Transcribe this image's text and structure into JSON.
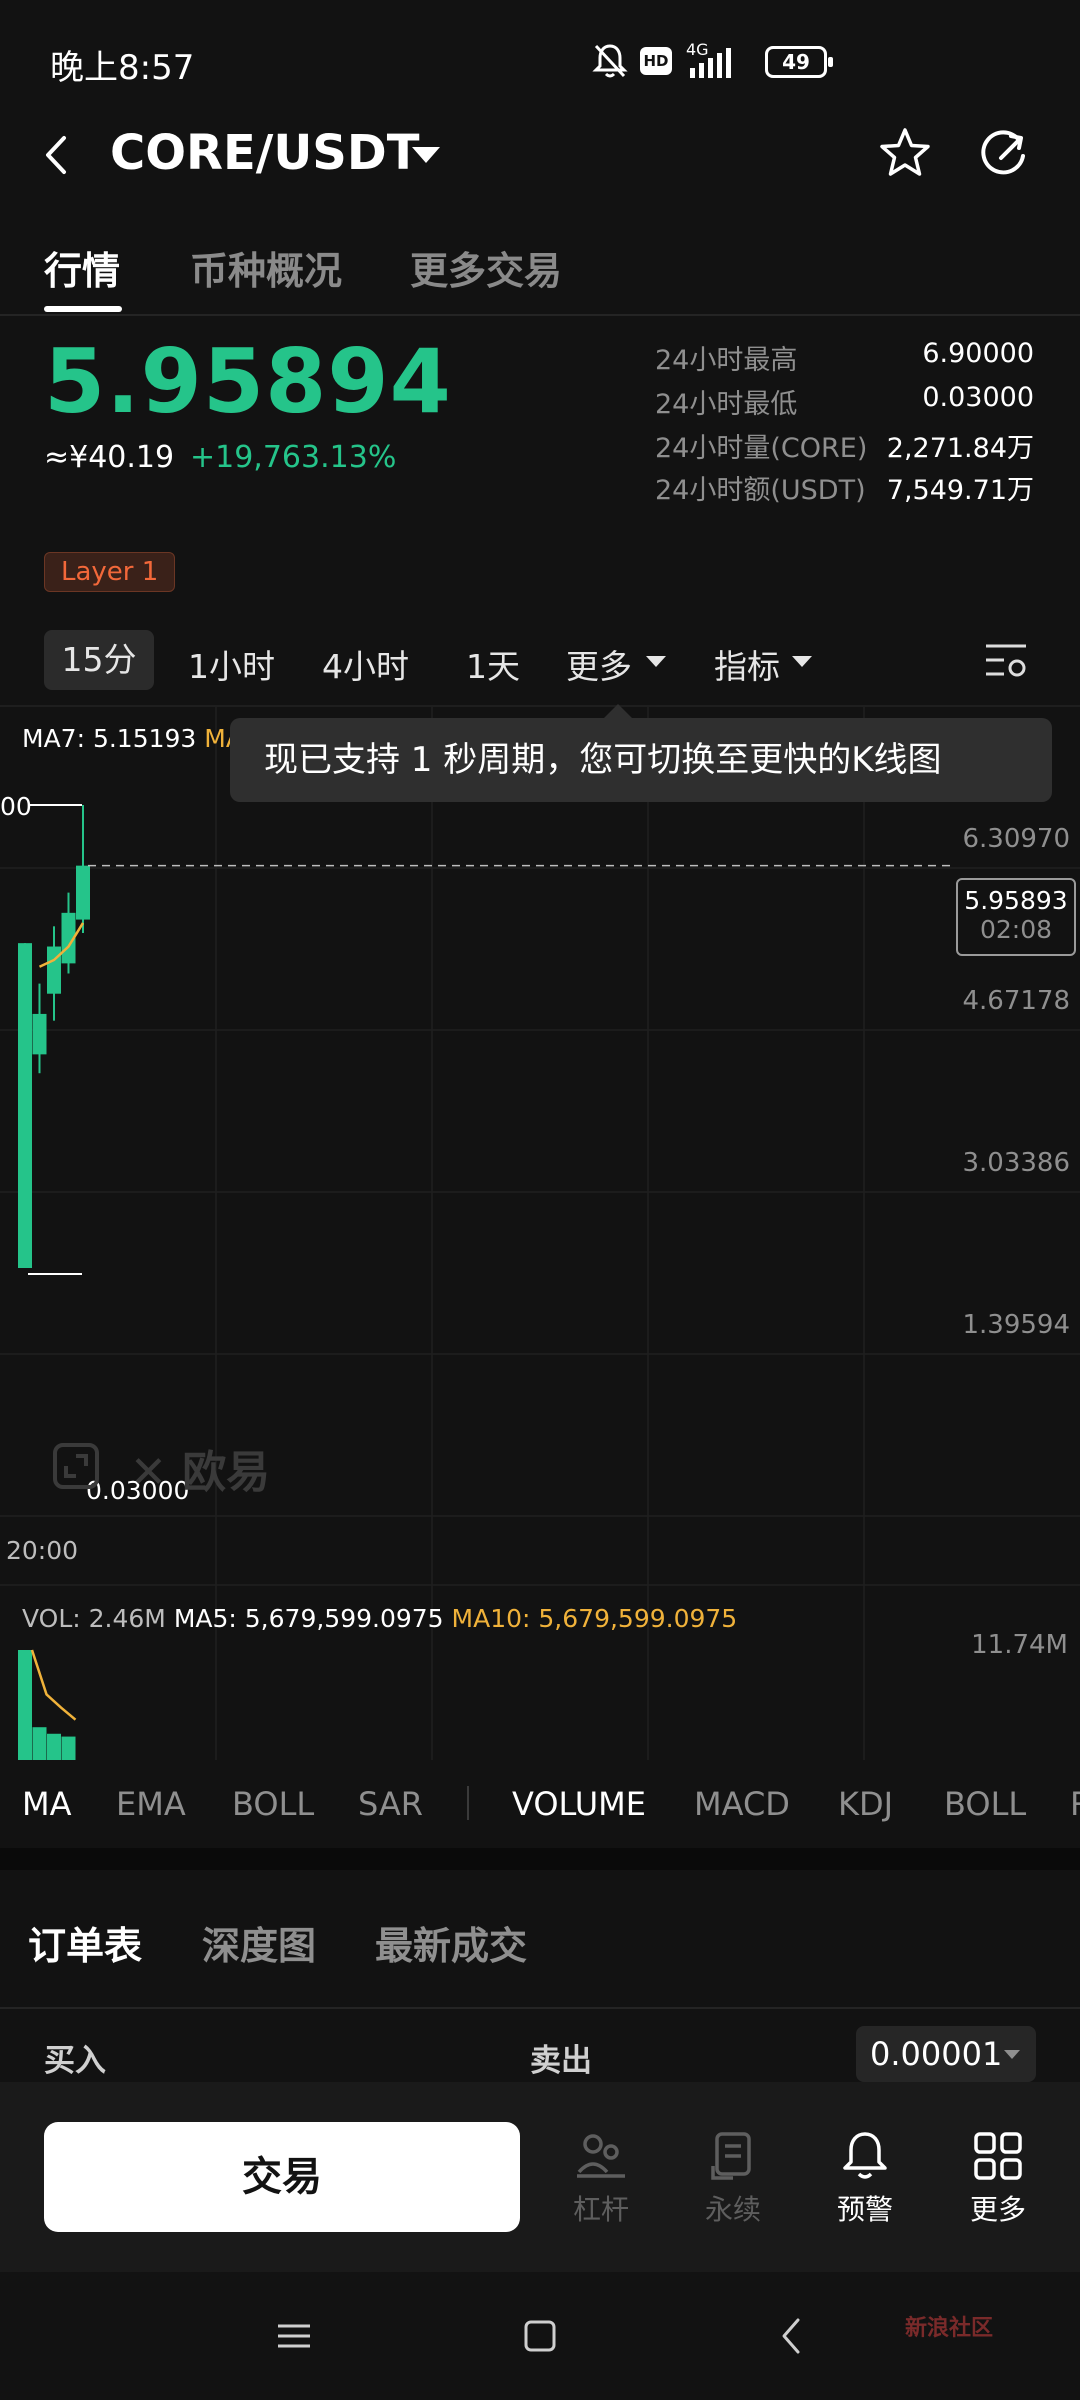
{
  "status": {
    "time": "晚上8:57",
    "net": "4G",
    "hd": "HD",
    "battery": "49"
  },
  "header": {
    "pair": "CORE/USDT"
  },
  "tabs": [
    "行情",
    "币种概况",
    "更多交易"
  ],
  "price": {
    "last": "5.95894",
    "cny": "≈¥40.19",
    "change": "+19,763.13%"
  },
  "stats": [
    {
      "label": "24小时最高",
      "value": "6.90000"
    },
    {
      "label": "24小时最低",
      "value": "0.03000"
    },
    {
      "label": "24小时量(CORE)",
      "value": "2,271.84万"
    },
    {
      "label": "24小时额(USDT)",
      "value": "7,549.71万"
    }
  ],
  "tag": "Layer 1",
  "periods": {
    "active": "15分",
    "p1": "1小时",
    "p2": "4小时",
    "p3": "1天",
    "more": "更多",
    "indicator": "指标"
  },
  "chart": {
    "ma7_label": "MA7: 5.15193",
    "ma_cut": "MA",
    "tooltip": "现已支持 1 秒周期，您可切换至更快的K线图",
    "high_cut": "00",
    "y_ticks": [
      "6.30970",
      "4.67178",
      "3.03386",
      "1.39594"
    ],
    "current_price": "5.95893",
    "countdown": "02:08",
    "low_label": "0.03000",
    "time_label": "20:00",
    "watermark": "欧易"
  },
  "chart_data": {
    "type": "candlestick",
    "candles": [
      {
        "open": 0.03,
        "close": 4.85,
        "high": 4.85,
        "low": 0.03
      },
      {
        "open": 3.2,
        "close": 3.8,
        "high": 4.25,
        "low": 2.92
      },
      {
        "open": 4.1,
        "close": 4.8,
        "high": 5.1,
        "low": 3.7
      },
      {
        "open": 4.55,
        "close": 5.3,
        "high": 5.6,
        "low": 4.4
      },
      {
        "open": 5.2,
        "close": 6.0,
        "high": 6.9,
        "low": 5.0
      }
    ],
    "ma7": [
      4.5,
      4.6,
      4.8,
      5.15
    ],
    "volume": [
      11.74,
      3.5,
      2.8,
      2.5
    ],
    "vol_ma": [
      11.74,
      7.0,
      5.6,
      4.3
    ],
    "ylim": [
      0.03,
      6.9
    ],
    "vol_max": 11.74
  },
  "volume": {
    "vol": "VOL: 2.46M",
    "ma5": "MA5: 5,679,599.0975",
    "ma10": "MA10: 5,679,599.0975",
    "max": "11.74M"
  },
  "indicators": [
    "MA",
    "EMA",
    "BOLL",
    "SAR",
    "VOLUME",
    "MACD",
    "KDJ",
    "BOLL",
    "R"
  ],
  "orderbook": {
    "tabs": [
      "订单表",
      "深度图",
      "最新成交"
    ],
    "buy": "买入",
    "sell": "卖出",
    "precision": "0.00001"
  },
  "bottom": {
    "trade": "交易",
    "items": [
      "杠杆",
      "永续",
      "预警",
      "更多"
    ]
  },
  "nav": {
    "badge": "新浪社区"
  },
  "colors": {
    "up": "#25c48a",
    "ma": "#f0b23a",
    "bg": "#121212"
  }
}
